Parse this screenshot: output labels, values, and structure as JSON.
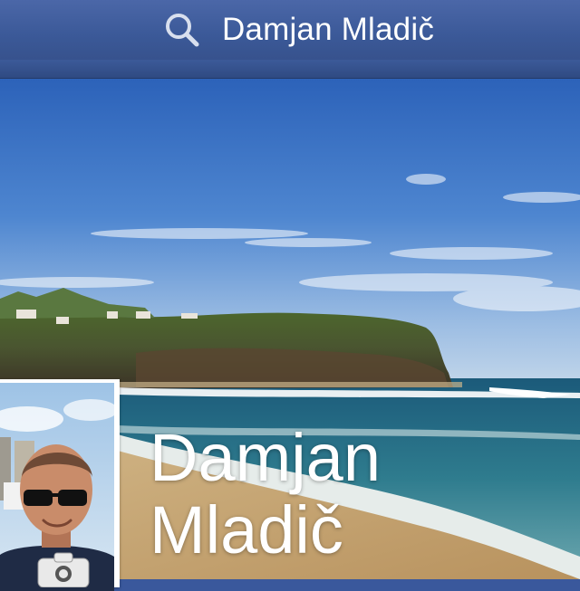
{
  "search": {
    "query": "Damjan Mladič",
    "icon": "search-icon"
  },
  "profile": {
    "first_name": "Damjan",
    "last_name": "Mladič",
    "camera_icon": "camera-icon"
  },
  "colors": {
    "navbar": "#3b5998",
    "text": "#ffffff"
  }
}
